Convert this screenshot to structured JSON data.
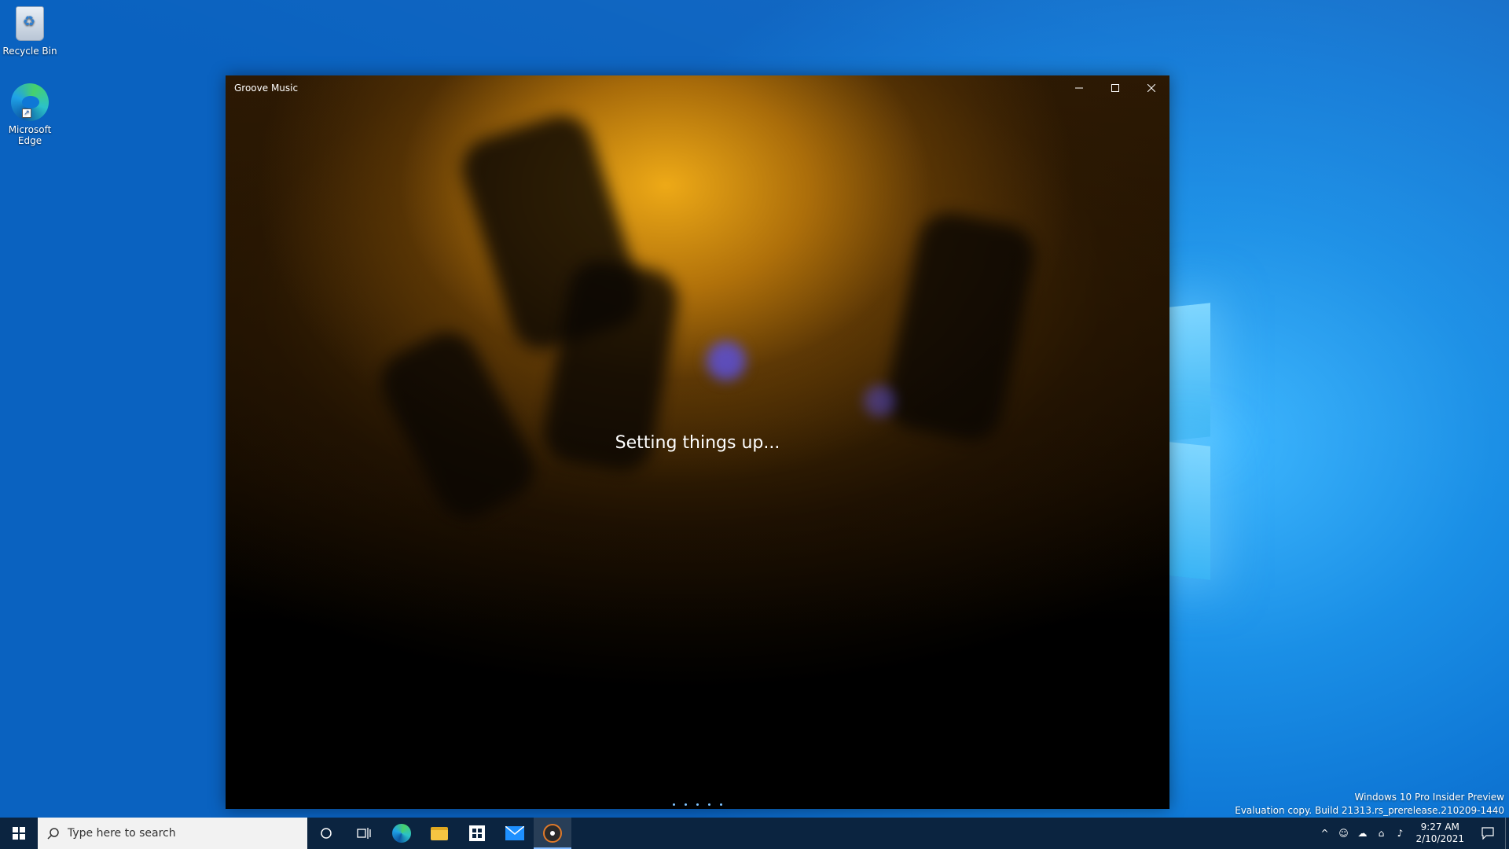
{
  "desktop": {
    "icons": [
      {
        "label": "Recycle Bin",
        "icon": "recycle-bin-icon"
      },
      {
        "label": "Microsoft Edge",
        "icon": "edge-icon"
      }
    ],
    "watermark": {
      "line1": "Windows 10 Pro Insider Preview",
      "line2": "Evaluation copy. Build 21313.rs_prerelease.210209-1440"
    }
  },
  "window": {
    "title": "Groove Music",
    "status": "Setting things up...",
    "controls": {
      "minimize": "—",
      "maximize": "☐",
      "close": "✕"
    }
  },
  "taskbar": {
    "search_placeholder": "Type here to search",
    "pinned": [
      "cortana-icon",
      "task-view-icon",
      "edge-icon",
      "file-explorer-icon",
      "store-icon",
      "mail-icon",
      "groove-music-icon"
    ],
    "active_app": "groove-music-icon",
    "clock": {
      "time": "9:27 AM",
      "date": "2/10/2021"
    }
  },
  "colors": {
    "desktop_accent": "#0f78d6",
    "taskbar_bg": "#0b2440",
    "window_glow": "#f6b018"
  }
}
